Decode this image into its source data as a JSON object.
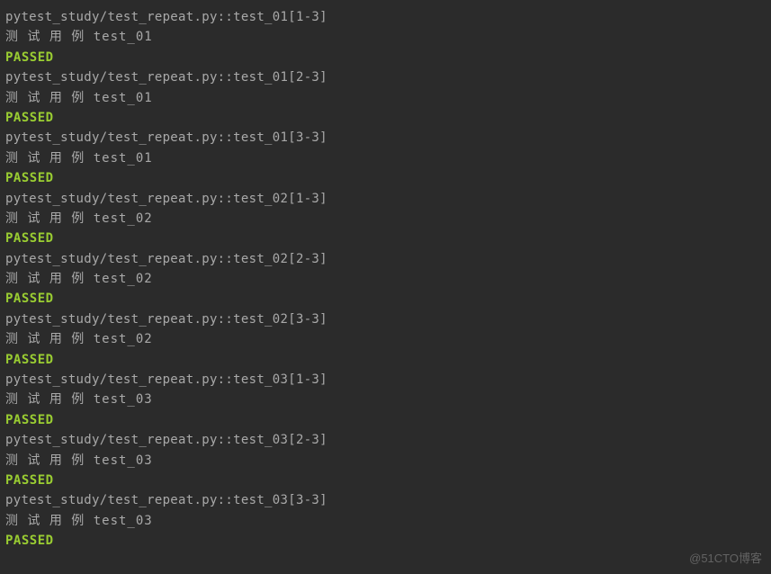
{
  "tests": [
    {
      "path": "pytest_study/test_repeat.py::test_01[1-3]",
      "output": "测 试 用 例 test_01",
      "status": "PASSED"
    },
    {
      "path": "pytest_study/test_repeat.py::test_01[2-3]",
      "output": "测 试 用 例 test_01",
      "status": "PASSED"
    },
    {
      "path": "pytest_study/test_repeat.py::test_01[3-3]",
      "output": "测 试 用 例 test_01",
      "status": "PASSED"
    },
    {
      "path": "pytest_study/test_repeat.py::test_02[1-3]",
      "output": "测 试 用 例 test_02",
      "status": "PASSED"
    },
    {
      "path": "pytest_study/test_repeat.py::test_02[2-3]",
      "output": "测 试 用 例 test_02",
      "status": "PASSED"
    },
    {
      "path": "pytest_study/test_repeat.py::test_02[3-3]",
      "output": "测 试 用 例 test_02",
      "status": "PASSED"
    },
    {
      "path": "pytest_study/test_repeat.py::test_03[1-3]",
      "output": "测 试 用 例 test_03",
      "status": "PASSED"
    },
    {
      "path": "pytest_study/test_repeat.py::test_03[2-3]",
      "output": "测 试 用 例 test_03",
      "status": "PASSED"
    },
    {
      "path": "pytest_study/test_repeat.py::test_03[3-3]",
      "output": "测 试 用 例 test_03",
      "status": "PASSED"
    }
  ],
  "watermark": "@51CTO博客"
}
